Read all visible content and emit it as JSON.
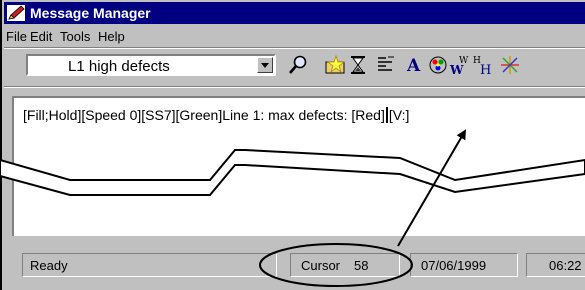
{
  "window": {
    "title": "Message Manager",
    "app_icon": "pen-icon"
  },
  "menu": {
    "items": [
      "File",
      "Edit",
      "Tools",
      "Help"
    ]
  },
  "toolbar": {
    "message_select": {
      "value": "L1 high defects"
    },
    "buttons": [
      {
        "name": "search-icon"
      },
      {
        "name": "star-folder-icon"
      },
      {
        "name": "hourglass-icon"
      },
      {
        "name": "align-icon"
      },
      {
        "name": "font-a-icon"
      },
      {
        "name": "color-palette-icon"
      },
      {
        "name": "width-icon",
        "glyph": "W"
      },
      {
        "name": "height-icon",
        "glyph": "H"
      },
      {
        "name": "sparkle-icon"
      }
    ]
  },
  "editor": {
    "text_before_caret": "[Fill;Hold][Speed 0][SS7][Green]Line 1: max defects: [Red]",
    "text_after_caret": "[V:]"
  },
  "status": {
    "state": "Ready",
    "cursor_label": "Cursor",
    "cursor_value": "58",
    "date": "07/06/1999",
    "time": "06:22"
  },
  "colors": {
    "titlebar": "#000080",
    "face": "#c0c0c0"
  }
}
